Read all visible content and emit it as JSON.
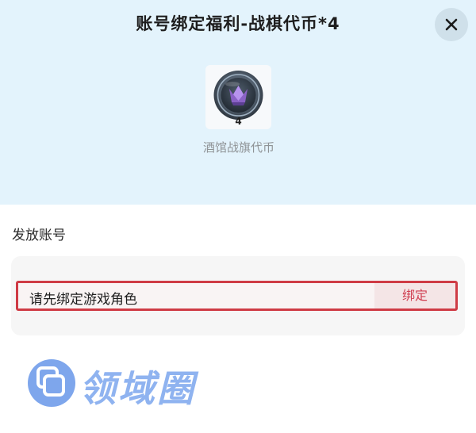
{
  "dialog": {
    "title": "账号绑定福利-战棋代币*4",
    "close_icon": "close-icon"
  },
  "reward": {
    "icon": "tavern-coin-icon",
    "count": "4",
    "name": "酒馆战旗代币"
  },
  "account_section": {
    "label": "发放账号",
    "hint": "请先绑定游戏角色",
    "bind_button_label": "绑定"
  },
  "watermark": {
    "icon": "watermark-logo-icon",
    "text": "领域圈"
  },
  "colors": {
    "header_bg": "#e3f3fc",
    "highlight_border": "#cf3b45",
    "bind_text": "#d04052",
    "watermark": "#8fb3f0"
  }
}
